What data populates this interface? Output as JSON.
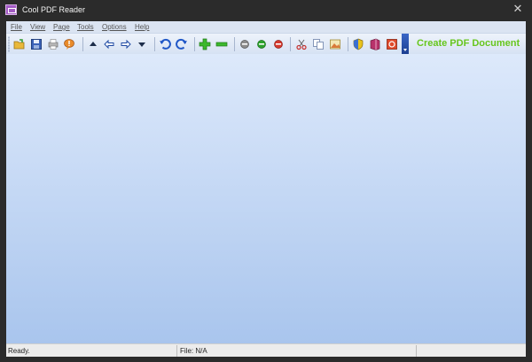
{
  "window": {
    "title": "Cool PDF Reader",
    "close_glyph": "✕"
  },
  "menu": [
    "File",
    "View",
    "Page",
    "Tools",
    "Options",
    "Help"
  ],
  "toolbar": {
    "icons": [
      "open-folder-icon",
      "save-icon",
      "print-icon",
      "comment-icon",
      "page-up-icon",
      "back-arrow-icon",
      "forward-arrow-icon",
      "page-down-icon",
      "rotate-left-icon",
      "rotate-right-icon",
      "zoom-in-icon",
      "zoom-out-icon",
      "gray-dot-icon",
      "green-dot-icon",
      "red-dot-icon",
      "cut-icon",
      "copy-icon",
      "image-icon",
      "shield-icon",
      "book-icon",
      "pdf-icon"
    ],
    "promo": "Create PDF Document",
    "promo_color": "#66c61c"
  },
  "status": {
    "left": "Ready.",
    "file": "File: N/A"
  },
  "colors": {
    "area_top": "#dde9fb",
    "area_bottom": "#a9c5ed"
  }
}
